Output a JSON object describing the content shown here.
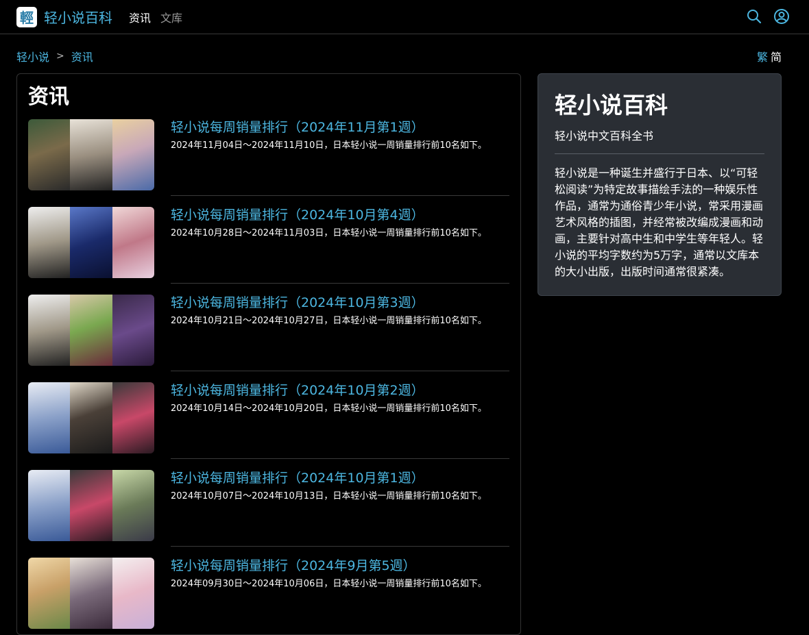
{
  "brand": {
    "logo_char": "輕",
    "name": "轻小说百科"
  },
  "nav": {
    "links": [
      {
        "label": "资讯",
        "active": true
      },
      {
        "label": "文库",
        "active": false
      }
    ]
  },
  "icons": {
    "search": "search-icon",
    "user": "user-circle-icon"
  },
  "breadcrumb": {
    "items": [
      "轻小说",
      "资讯"
    ],
    "separator": ">"
  },
  "lang": {
    "traditional": "繁",
    "simplified": "简"
  },
  "main": {
    "title": "资讯",
    "articles": [
      {
        "title": "轻小说每周销量排行（2024年11月第1週）",
        "desc": "2024年11月04日～2024年11月10日，日本轻小说一周销量排行前10名如下。"
      },
      {
        "title": "轻小说每周销量排行（2024年10月第4週）",
        "desc": "2024年10月28日～2024年11月03日，日本轻小说一周销量排行前10名如下。"
      },
      {
        "title": "轻小说每周销量排行（2024年10月第3週）",
        "desc": "2024年10月21日～2024年10月27日，日本轻小说一周销量排行前10名如下。"
      },
      {
        "title": "轻小说每周销量排行（2024年10月第2週）",
        "desc": "2024年10月14日～2024年10月20日，日本轻小说一周销量排行前10名如下。"
      },
      {
        "title": "轻小说每周销量排行（2024年10月第1週）",
        "desc": "2024年10月07日～2024年10月13日，日本轻小说一周销量排行前10名如下。"
      },
      {
        "title": "轻小说每周销量排行（2024年9月第5週）",
        "desc": "2024年09月30日～2024年10月06日，日本轻小说一周销量排行前10名如下。"
      }
    ]
  },
  "sidebar": {
    "title": "轻小说百科",
    "subtitle": "轻小说中文百科全书",
    "text": "轻小说是一种诞生并盛行于日本、以“可轻松阅读”为特定故事描绘手法的一种娱乐性作品，通常为通俗青少年小说，常采用漫画艺术风格的插图，并经常被改编成漫画和动画，主要针对高中生和中学生等年轻人。轻小说的平均字数约为5万字，通常以文库本的大小出版，出版时间通常很紧凑。"
  },
  "colors": {
    "accent": "#4cb6e0",
    "background": "#000000",
    "sidebar_bg": "#2a2e34"
  }
}
